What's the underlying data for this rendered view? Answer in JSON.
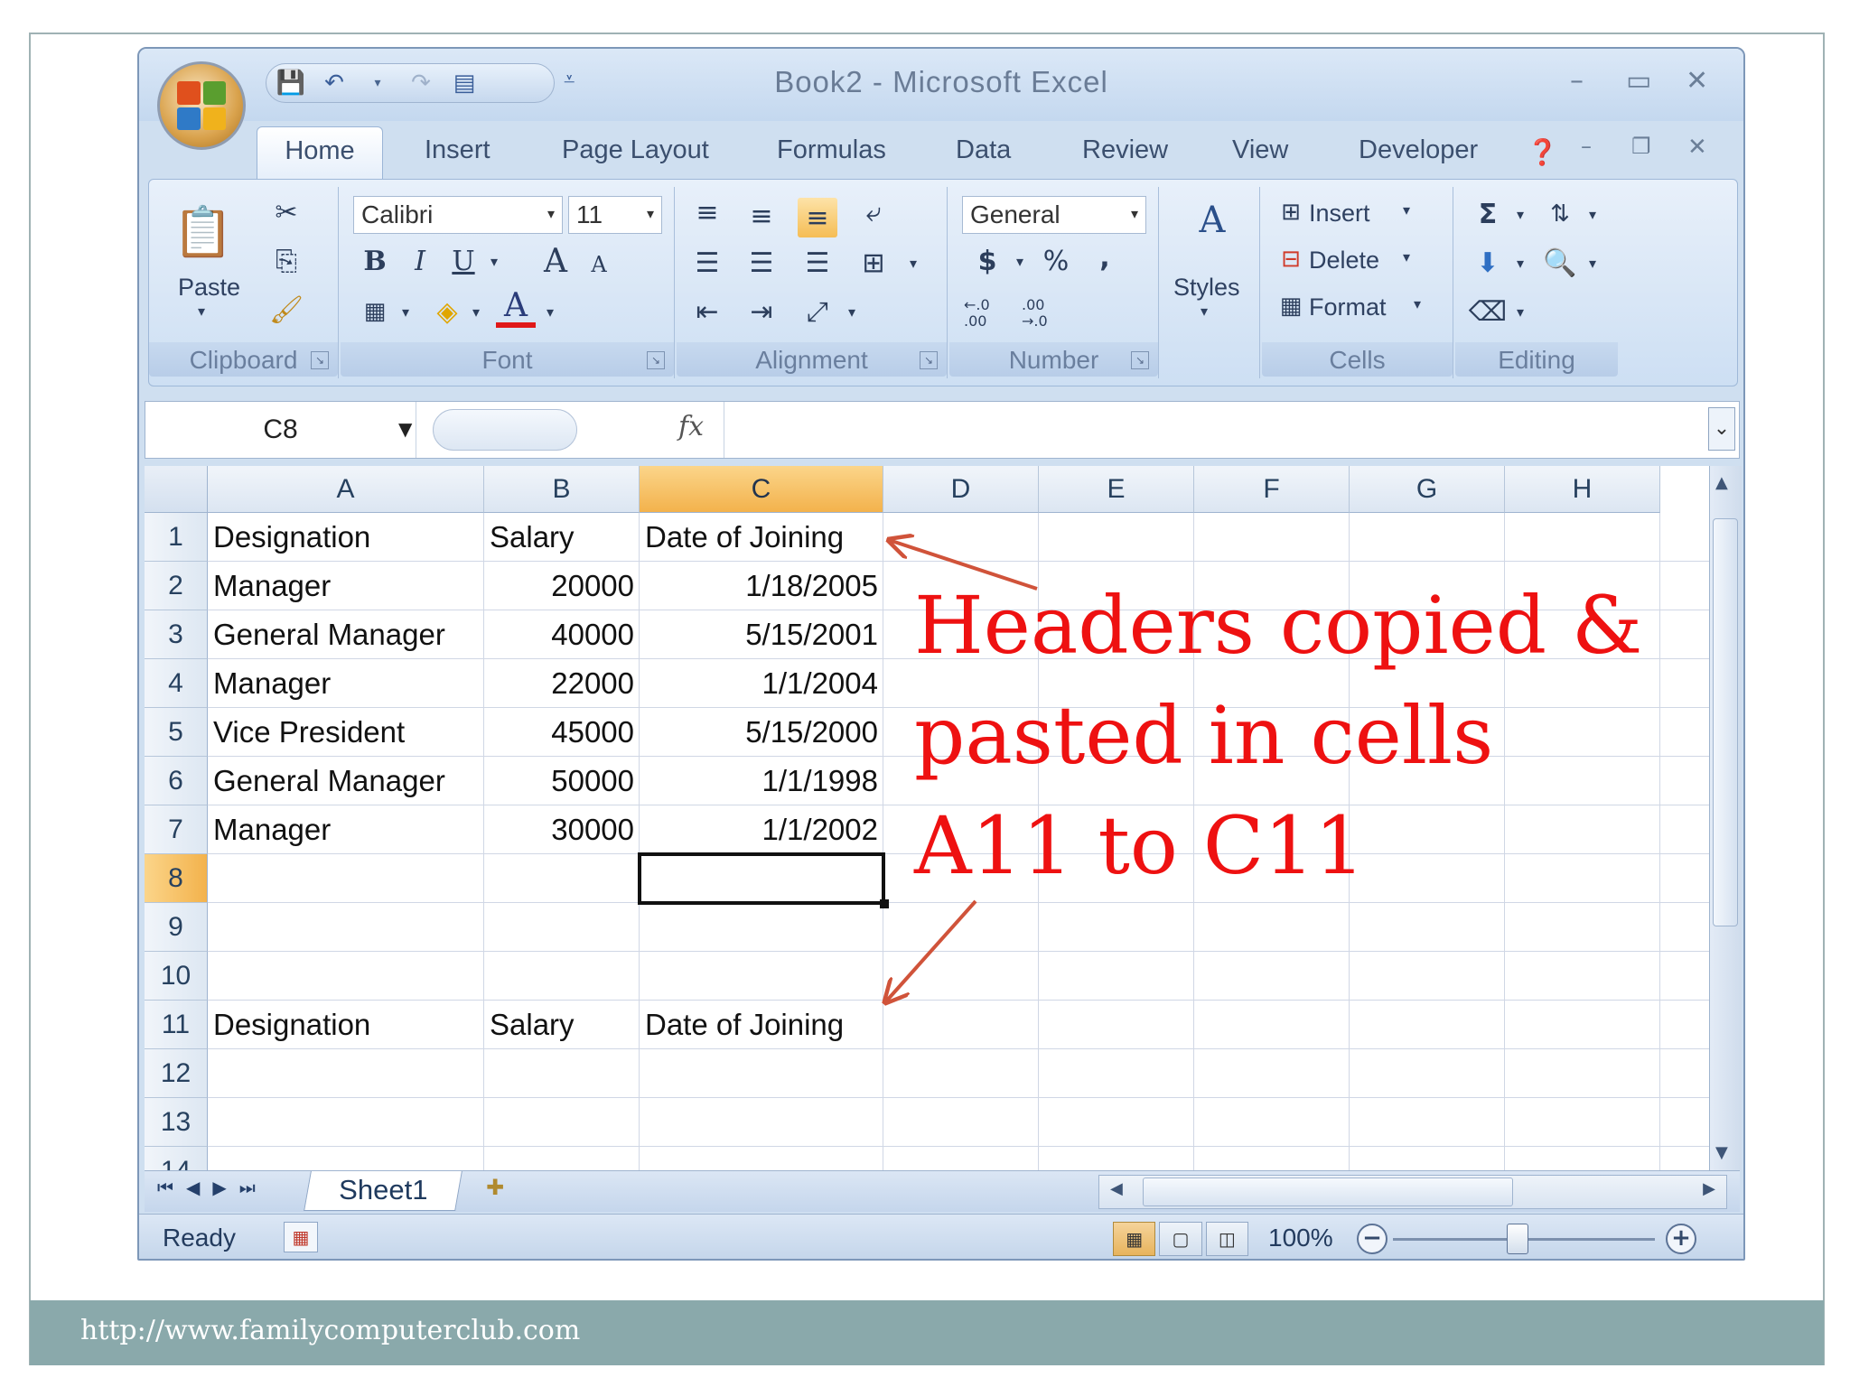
{
  "footer": {
    "url": "http://www.familycomputerclub.com"
  },
  "window": {
    "title": "Book2  -  Microsoft Excel",
    "min_glyph": "–",
    "max_glyph": "▭",
    "close_glyph": "✕"
  },
  "tabs": [
    "Home",
    "Insert",
    "Page Layout",
    "Formulas",
    "Data",
    "Review",
    "View",
    "Developer"
  ],
  "ribbon": {
    "clipboard": {
      "label": "Clipboard",
      "paste_label": "Paste"
    },
    "font": {
      "label": "Font",
      "font_name": "Calibri",
      "font_size": "11",
      "bold": "B",
      "italic": "I",
      "underline": "U",
      "grow": "A",
      "shrink": "A",
      "font_color": "A"
    },
    "alignment": {
      "label": "Alignment"
    },
    "number": {
      "label": "Number",
      "format": "General",
      "currency": "$",
      "percent": "%",
      "comma": ",",
      "inc_decimal": "←.0 .00",
      "dec_decimal": ".00 →.0"
    },
    "styles": {
      "label": "Styles"
    },
    "cells": {
      "label": "Cells",
      "insert": "Insert",
      "delete": "Delete",
      "format": "Format"
    },
    "editing": {
      "label": "Editing",
      "sum": "Σ"
    }
  },
  "formula_bar": {
    "name_box": "C8",
    "fx": "fx",
    "content": ""
  },
  "grid": {
    "columns": [
      "A",
      "B",
      "C",
      "D",
      "E",
      "F",
      "G",
      "H"
    ],
    "selected_column": "C",
    "rows": [
      "1",
      "2",
      "3",
      "4",
      "5",
      "6",
      "7",
      "8",
      "9",
      "10",
      "11",
      "12",
      "13",
      "14"
    ],
    "selected_row": "8",
    "cells": [
      [
        "Designation",
        "Salary",
        "Date of Joining"
      ],
      [
        "Manager",
        "20000",
        "1/18/2005"
      ],
      [
        "General Manager",
        "40000",
        "5/15/2001"
      ],
      [
        "Manager",
        "22000",
        "1/1/2004"
      ],
      [
        "Vice President",
        "45000",
        "5/15/2000"
      ],
      [
        "General Manager",
        "50000",
        "1/1/1998"
      ],
      [
        "Manager",
        "30000",
        "1/1/2002"
      ],
      [
        "",
        "",
        ""
      ],
      [
        "",
        "",
        ""
      ],
      [
        "",
        "",
        ""
      ],
      [
        "Designation",
        "Salary",
        "Date of Joining"
      ],
      [
        "",
        "",
        ""
      ],
      [
        "",
        "",
        ""
      ]
    ],
    "active_cell": "C8"
  },
  "sheet_tabs": {
    "active": "Sheet1"
  },
  "status": {
    "ready": "Ready",
    "zoom": "100%"
  },
  "annotation": {
    "lines": [
      "Headers copied &",
      "pasted in cells",
      "A11 to C11"
    ],
    "color": "#ee1111",
    "arrow_color": "#d0533a"
  }
}
